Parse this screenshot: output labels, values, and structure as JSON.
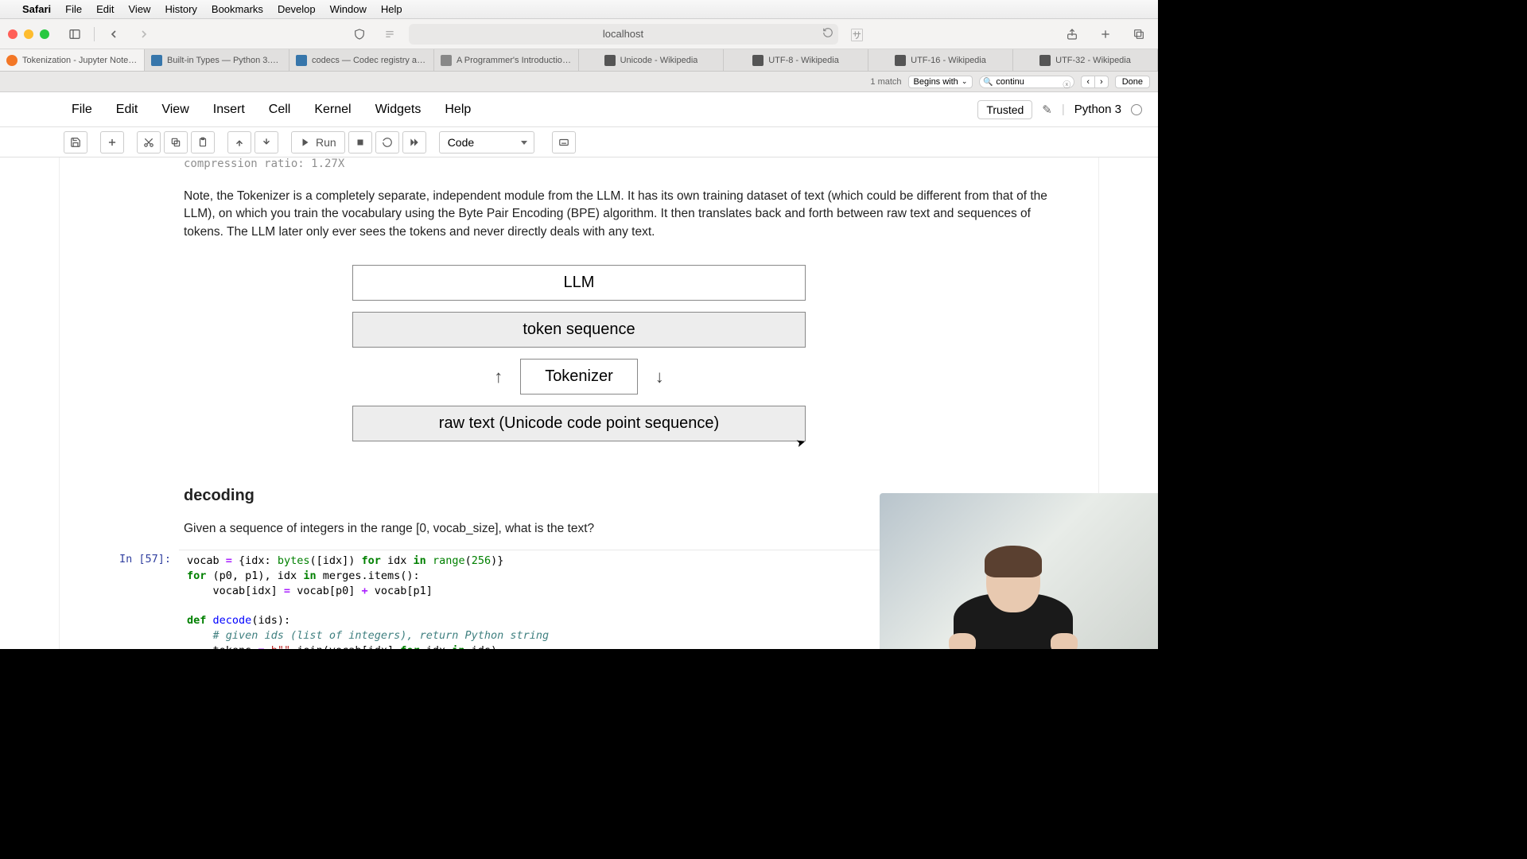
{
  "macos_menu": {
    "app": "Safari",
    "items": [
      "File",
      "Edit",
      "View",
      "History",
      "Bookmarks",
      "Develop",
      "Window",
      "Help"
    ]
  },
  "url": "localhost",
  "tabs": [
    {
      "label": "Tokenization - Jupyter Notebook",
      "active": true,
      "favcolor": "#f37726"
    },
    {
      "label": "Built-in Types — Python 3.12.2...",
      "active": false,
      "favcolor": "#3776ab"
    },
    {
      "label": "codecs — Codec registry and b...",
      "active": false,
      "favcolor": "#3776ab"
    },
    {
      "label": "A Programmer's Introduction to...",
      "active": false,
      "favcolor": "#888"
    },
    {
      "label": "Unicode - Wikipedia",
      "active": false,
      "favcolor": "#555"
    },
    {
      "label": "UTF-8 - Wikipedia",
      "active": false,
      "favcolor": "#555"
    },
    {
      "label": "UTF-16 - Wikipedia",
      "active": false,
      "favcolor": "#555"
    },
    {
      "label": "UTF-32 - Wikipedia",
      "active": false,
      "favcolor": "#555"
    }
  ],
  "find": {
    "matches": "1 match",
    "mode": "Begins with",
    "query": "continu",
    "done": "Done"
  },
  "jupyter": {
    "menus": [
      "File",
      "Edit",
      "View",
      "Insert",
      "Cell",
      "Kernel",
      "Widgets",
      "Help"
    ],
    "trusted": "Trusted",
    "kernel": "Python 3",
    "cell_type": "Code",
    "run": "Run"
  },
  "content": {
    "partial_output": "compression ratio: 1.27X",
    "md1": "Note, the Tokenizer is a completely separate, independent module from the LLM. It has its own training dataset of text (which could be different from that of the LLM), on which you train the vocabulary using the Byte Pair Encoding (BPE) algorithm. It then translates back and forth between raw text and sequences of tokens. The LLM later only ever sees the tokens and never directly deals with any text.",
    "diagram": {
      "llm": "LLM",
      "tokens": "token sequence",
      "tokenizer": "Tokenizer",
      "raw": "raw text (Unicode code point sequence)"
    },
    "heading": "decoding",
    "md2": "Given a sequence of integers in the range [0, vocab_size], what is the text?",
    "prompt": "In [57]:"
  }
}
